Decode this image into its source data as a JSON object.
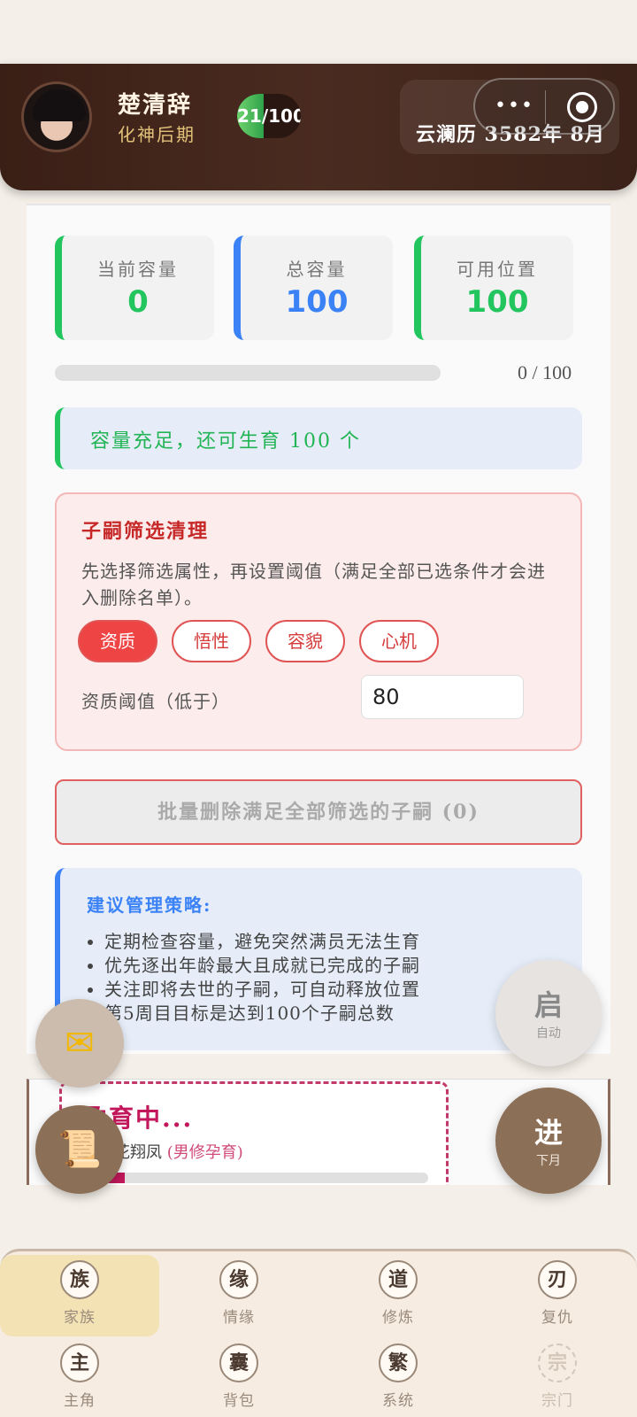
{
  "header": {
    "name": "楚清辞",
    "rank": "化神后期",
    "lifespan": "21/100",
    "lifespan_fraction": 0.21,
    "date": "云澜历 3582年 8月"
  },
  "capacity": {
    "current_label": "当前容量",
    "current_value": "0",
    "total_label": "总容量",
    "total_value": "100",
    "available_label": "可用位置",
    "available_value": "100",
    "progress_text": "0 / 100",
    "progress_fraction": 0,
    "notice": "容量充足，还可生育 100 个"
  },
  "filter": {
    "title": "子嗣筛选清理",
    "description": "先选择筛选属性，再设置阈值（满足全部已选条件才会进入删除名单）。",
    "chips": [
      "资质",
      "悟性",
      "容貌",
      "心机"
    ],
    "active_chip": "资质",
    "threshold_label": "资质阈值（低于）",
    "threshold_value": "80"
  },
  "batch_delete_label": "批量删除满足全部筛选的子嗣 (0)",
  "tips": {
    "title": "建议管理策略:",
    "items": [
      "定期检查容量，避免突然满员无法生育",
      "优先逐出年龄最大且成就已完成的子嗣",
      "关注即将去世的子嗣，可自动释放位置",
      "第5周目目标是达到100个子嗣总数"
    ]
  },
  "pregnancy": {
    "title": "孕育中...",
    "partner_prefix": "父：花翔凤",
    "partner_note": "(男修孕育)",
    "progress_fraction": 0.12
  },
  "fabs": {
    "auto_big": "启",
    "auto_small": "自动",
    "next_big": "进",
    "next_small": "下月"
  },
  "nav": [
    {
      "icon": "族",
      "label": "家族"
    },
    {
      "icon": "缘",
      "label": "情缘"
    },
    {
      "icon": "道",
      "label": "修炼"
    },
    {
      "icon": "刃",
      "label": "复仇"
    },
    {
      "icon": "主",
      "label": "主角"
    },
    {
      "icon": "囊",
      "label": "背包"
    },
    {
      "icon": "繁",
      "label": "系统"
    },
    {
      "icon": "宗",
      "label": "宗门"
    }
  ],
  "colors": {
    "accent_green": "#22c55e",
    "accent_blue": "#3b82f6",
    "danger_red": "#ef4444",
    "header_brown": "#3a1f16",
    "fab_brown": "#8b6f56"
  }
}
